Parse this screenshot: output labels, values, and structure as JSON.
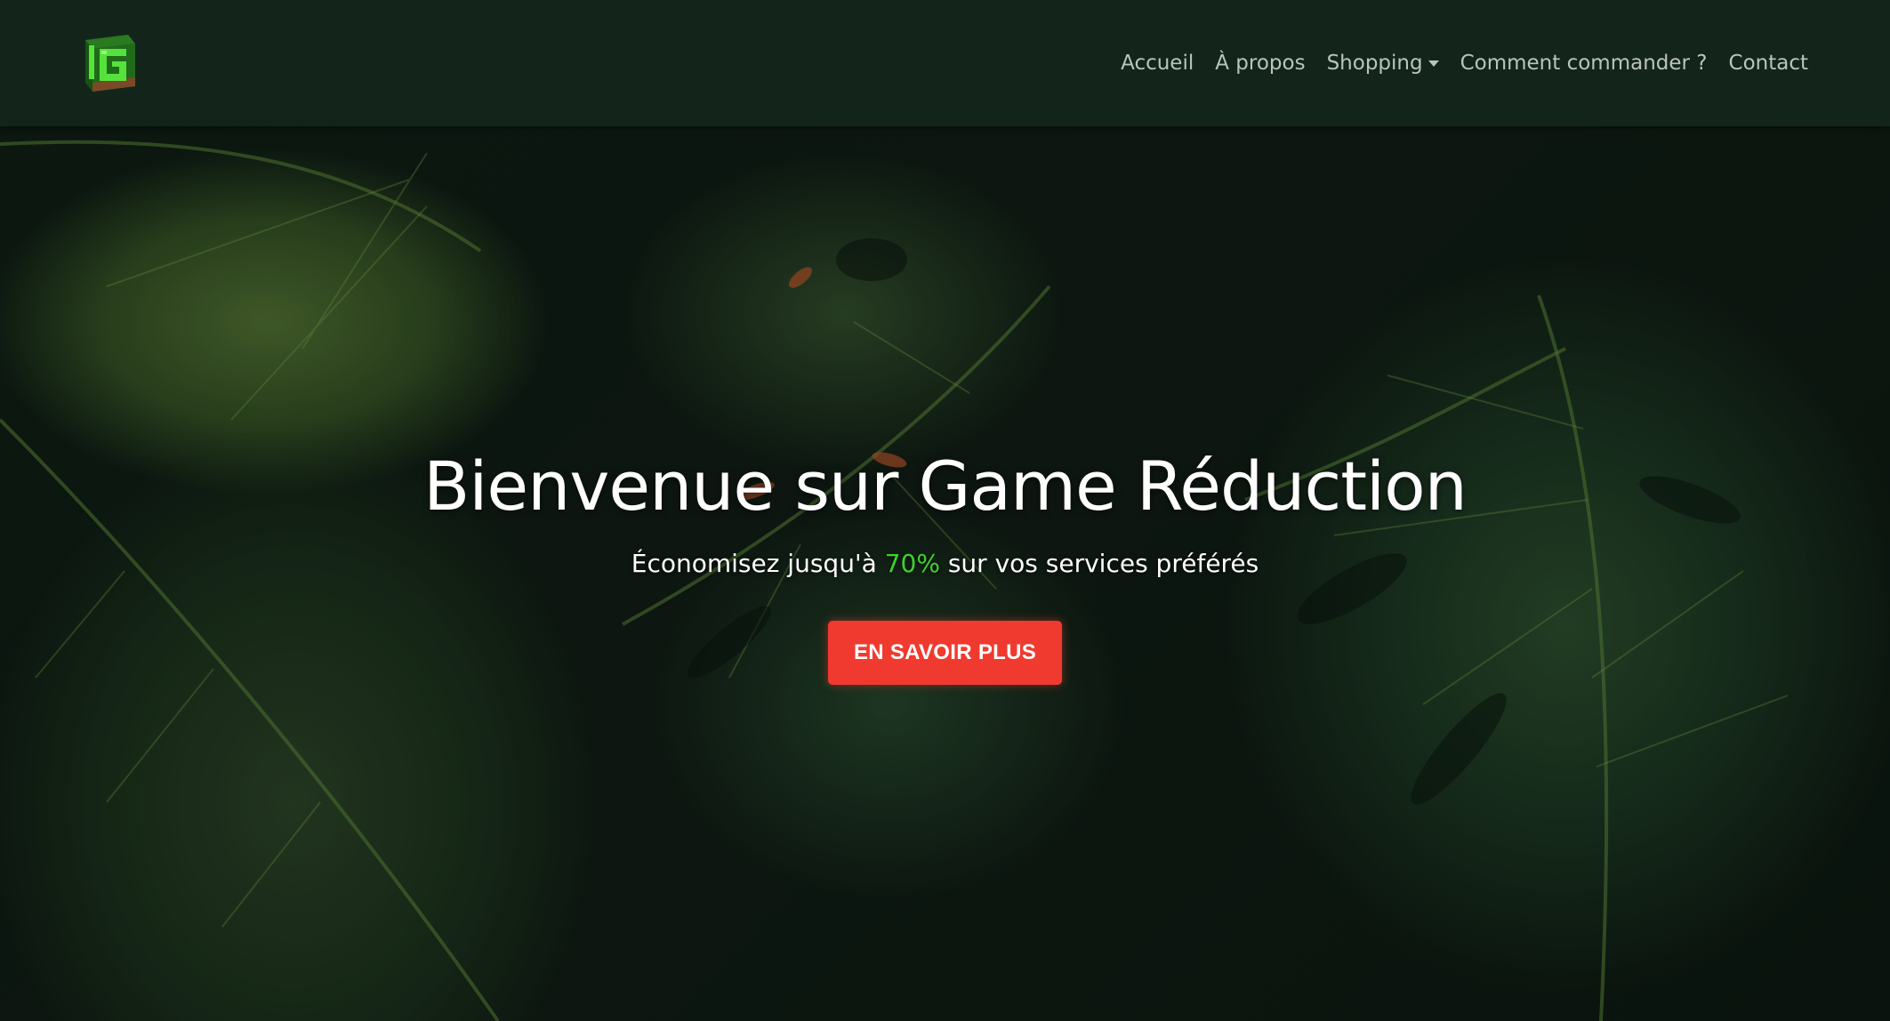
{
  "brand": {
    "logo_icon": "game-reduction-logo",
    "accent_color": "#3fd12f"
  },
  "nav": {
    "items": [
      {
        "label": "Accueil"
      },
      {
        "label": "À propos"
      },
      {
        "label": "Shopping",
        "has_dropdown": true
      },
      {
        "label": "Comment commander ?"
      },
      {
        "label": "Contact"
      }
    ]
  },
  "hero": {
    "title": "Bienvenue sur Game Réduction",
    "subtitle_before": "Économisez jusqu'à ",
    "subtitle_highlight": "70%",
    "subtitle_after": " sur vos services préférés",
    "cta_label": "EN SAVOIR PLUS",
    "cta_color": "#f13a2f",
    "background": "tropical-leaves-photo"
  }
}
